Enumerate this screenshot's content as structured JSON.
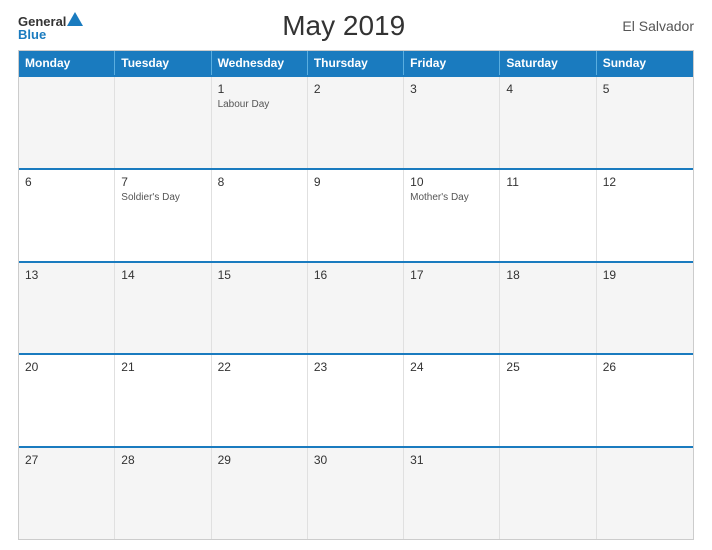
{
  "header": {
    "logo_general": "General",
    "logo_blue": "Blue",
    "title": "May 2019",
    "country": "El Salvador"
  },
  "calendar": {
    "days_of_week": [
      "Monday",
      "Tuesday",
      "Wednesday",
      "Thursday",
      "Friday",
      "Saturday",
      "Sunday"
    ],
    "rows": [
      [
        {
          "day": "",
          "holiday": ""
        },
        {
          "day": "",
          "holiday": ""
        },
        {
          "day": "1",
          "holiday": "Labour Day"
        },
        {
          "day": "2",
          "holiday": ""
        },
        {
          "day": "3",
          "holiday": ""
        },
        {
          "day": "4",
          "holiday": ""
        },
        {
          "day": "5",
          "holiday": ""
        }
      ],
      [
        {
          "day": "6",
          "holiday": ""
        },
        {
          "day": "7",
          "holiday": "Soldier's Day"
        },
        {
          "day": "8",
          "holiday": ""
        },
        {
          "day": "9",
          "holiday": ""
        },
        {
          "day": "10",
          "holiday": "Mother's Day"
        },
        {
          "day": "11",
          "holiday": ""
        },
        {
          "day": "12",
          "holiday": ""
        }
      ],
      [
        {
          "day": "13",
          "holiday": ""
        },
        {
          "day": "14",
          "holiday": ""
        },
        {
          "day": "15",
          "holiday": ""
        },
        {
          "day": "16",
          "holiday": ""
        },
        {
          "day": "17",
          "holiday": ""
        },
        {
          "day": "18",
          "holiday": ""
        },
        {
          "day": "19",
          "holiday": ""
        }
      ],
      [
        {
          "day": "20",
          "holiday": ""
        },
        {
          "day": "21",
          "holiday": ""
        },
        {
          "day": "22",
          "holiday": ""
        },
        {
          "day": "23",
          "holiday": ""
        },
        {
          "day": "24",
          "holiday": ""
        },
        {
          "day": "25",
          "holiday": ""
        },
        {
          "day": "26",
          "holiday": ""
        }
      ],
      [
        {
          "day": "27",
          "holiday": ""
        },
        {
          "day": "28",
          "holiday": ""
        },
        {
          "day": "29",
          "holiday": ""
        },
        {
          "day": "30",
          "holiday": ""
        },
        {
          "day": "31",
          "holiday": ""
        },
        {
          "day": "",
          "holiday": ""
        },
        {
          "day": "",
          "holiday": ""
        }
      ]
    ]
  }
}
